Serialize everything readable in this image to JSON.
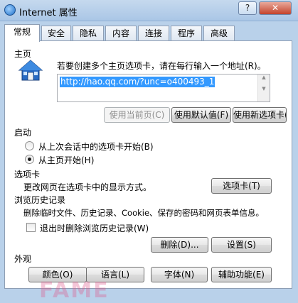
{
  "window": {
    "title": "Internet 属性",
    "help_label": "?",
    "close_label": "✕"
  },
  "tabs": [
    {
      "label": "常规",
      "active": true
    },
    {
      "label": "安全",
      "active": false
    },
    {
      "label": "隐私",
      "active": false
    },
    {
      "label": "内容",
      "active": false
    },
    {
      "label": "连接",
      "active": false
    },
    {
      "label": "程序",
      "active": false
    },
    {
      "label": "高级",
      "active": false
    }
  ],
  "home": {
    "section_label": "主页",
    "description": "若要创建多个主页选项卡，请在每行输入一个地址(R)。",
    "url_value": "http://hao.qq.com/?unc=o400493_1",
    "use_current_label": "使用当前页(C)",
    "use_default_label": "使用默认值(F)",
    "use_new_tab_label": "使用新选项卡(U)"
  },
  "startup": {
    "section_label": "启动",
    "option_last_session": "从上次会话中的选项卡开始(B)",
    "option_home": "从主页开始(H)",
    "selected": "home"
  },
  "tabs_section": {
    "section_label": "选项卡",
    "description": "更改网页在选项卡中的显示方式。",
    "tabs_button_label": "选项卡(T)"
  },
  "history": {
    "section_label": "浏览历史记录",
    "description": "删除临时文件、历史记录、Cookie、保存的密码和网页表单信息。",
    "delete_on_exit_label": "退出时删除浏览历史记录(W)",
    "delete_on_exit_checked": false,
    "delete_button_label": "删除(D)...",
    "settings_button_label": "设置(S)"
  },
  "appearance": {
    "section_label": "外观",
    "colors_label": "颜色(O)",
    "languages_label": "语言(L)",
    "fonts_label": "字体(N)",
    "accessibility_label": "辅助功能(E)"
  },
  "colors": {
    "accent": "#3399ff",
    "dialog_background": "#ffffff",
    "frame": "#b9d1ea",
    "close_button": "#c4432b"
  },
  "icons": [
    "internet-explorer-icon",
    "home-house-icon"
  ],
  "watermark": {
    "text": "FAME"
  }
}
